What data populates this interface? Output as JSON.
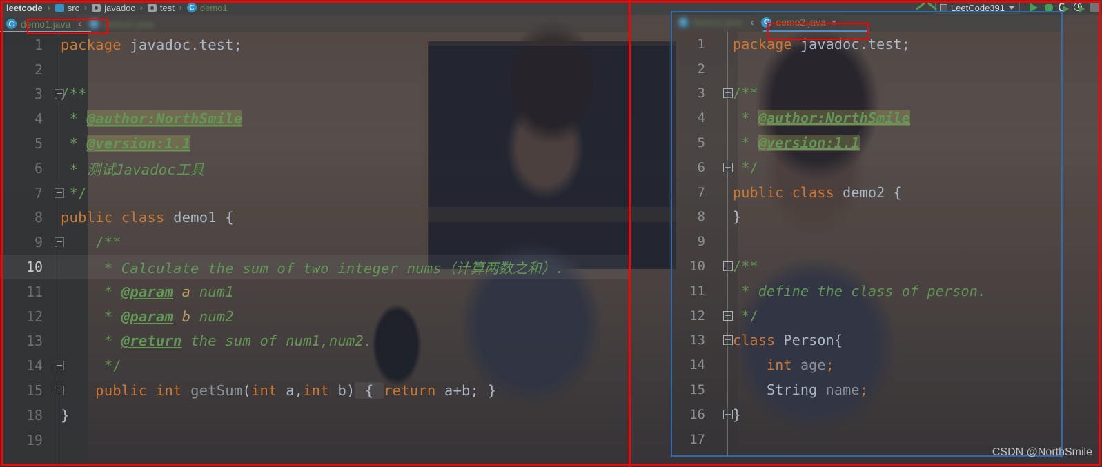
{
  "window": {
    "watermark": "CSDN @NorthSmile"
  },
  "breadcrumb": {
    "items": [
      {
        "label": "leetcode",
        "icon": "project-icon",
        "bold": true
      },
      {
        "label": "src",
        "icon": "folder-icon",
        "bold": false
      },
      {
        "label": "javadoc",
        "icon": "package-icon",
        "bold": false
      },
      {
        "label": "test",
        "icon": "package-icon",
        "bold": false
      },
      {
        "label": "demo1",
        "icon": "java-class-icon",
        "bold": false
      }
    ],
    "separator": "›"
  },
  "toolbar": {
    "hide_label": "hide-toolbar-icon",
    "run_config": "LeetCode391",
    "dropdown_caret": "▾",
    "buttons": [
      {
        "name": "run-button",
        "icon": "play-icon"
      },
      {
        "name": "debug-button",
        "icon": "bug-icon"
      },
      {
        "name": "run-with-coverage-button",
        "icon": "coverage-icon"
      },
      {
        "name": "profile-button",
        "icon": "profiler-icon"
      },
      {
        "name": "stop-button",
        "icon": "stop-icon"
      }
    ]
  },
  "left_editor": {
    "tabs": [
      {
        "label": "demo1.java",
        "active": true,
        "blurred": false,
        "icon": "java-class-icon"
      },
      {
        "label": "demo2.java",
        "active": false,
        "blurred": true,
        "icon": "java-class-icon"
      }
    ],
    "tab_overflow": "‹",
    "lines": [
      {
        "n": "1",
        "current": false,
        "fold": "",
        "tokens": [
          {
            "t": "package ",
            "c": "kw"
          },
          {
            "t": "javadoc.test",
            "c": "txt"
          },
          {
            "t": ";",
            "c": "txt"
          }
        ]
      },
      {
        "n": "2",
        "current": false,
        "fold": "",
        "tokens": []
      },
      {
        "n": "3",
        "current": false,
        "fold": "start",
        "tokens": [
          {
            "t": "/**",
            "c": "cmt-plain"
          }
        ]
      },
      {
        "n": "4",
        "current": false,
        "fold": "",
        "tokens": [
          {
            "t": " * ",
            "c": "cmt-plain"
          },
          {
            "t": "@author:NorthSmile",
            "c": "tag hlb"
          }
        ]
      },
      {
        "n": "5",
        "current": false,
        "fold": "",
        "tokens": [
          {
            "t": " * ",
            "c": "cmt-plain"
          },
          {
            "t": "@version:1.1",
            "c": "tag hlb"
          }
        ]
      },
      {
        "n": "6",
        "current": false,
        "fold": "",
        "tokens": [
          {
            "t": " * ",
            "c": "cmt-plain"
          },
          {
            "t": "测试Javadoc工具",
            "c": "cmt"
          }
        ]
      },
      {
        "n": "7",
        "current": false,
        "fold": "end",
        "tokens": [
          {
            "t": " */",
            "c": "cmt-plain"
          }
        ]
      },
      {
        "n": "8",
        "current": false,
        "fold": "",
        "tokens": [
          {
            "t": "public ",
            "c": "kw"
          },
          {
            "t": "class ",
            "c": "kw"
          },
          {
            "t": "demo1",
            "c": "txt"
          },
          {
            "t": " {",
            "c": "brace"
          }
        ]
      },
      {
        "n": "9",
        "current": false,
        "fold": "start",
        "tokens": [
          {
            "t": "    /**",
            "c": "cmt-plain"
          }
        ]
      },
      {
        "n": "10",
        "current": true,
        "fold": "",
        "tokens": [
          {
            "t": "     * ",
            "c": "cmt-plain"
          },
          {
            "t": "Calculate the sum of two integer nums（计算两数之和）.",
            "c": "cmt"
          }
        ]
      },
      {
        "n": "11",
        "current": false,
        "fold": "",
        "tokens": [
          {
            "t": "     * ",
            "c": "cmt-plain"
          },
          {
            "t": "@param",
            "c": "tagp"
          },
          {
            "t": " a",
            "c": "param"
          },
          {
            "t": " num1",
            "c": "cmt"
          }
        ]
      },
      {
        "n": "12",
        "current": false,
        "fold": "",
        "tokens": [
          {
            "t": "     * ",
            "c": "cmt-plain"
          },
          {
            "t": "@param",
            "c": "tagp"
          },
          {
            "t": " b",
            "c": "param"
          },
          {
            "t": " num2",
            "c": "cmt"
          }
        ]
      },
      {
        "n": "13",
        "current": false,
        "fold": "",
        "tokens": [
          {
            "t": "     * ",
            "c": "cmt-plain"
          },
          {
            "t": "@return",
            "c": "tagp"
          },
          {
            "t": " the sum of num1,num2.",
            "c": "cmt"
          }
        ]
      },
      {
        "n": "14",
        "current": false,
        "fold": "end",
        "tokens": [
          {
            "t": "     */",
            "c": "cmt-plain"
          }
        ]
      },
      {
        "n": "15",
        "current": false,
        "fold": "plus",
        "tokens": [
          {
            "t": "    public ",
            "c": "kw"
          },
          {
            "t": "int ",
            "c": "kw"
          },
          {
            "t": "getSum",
            "c": "mname"
          },
          {
            "t": "(",
            "c": "brace"
          },
          {
            "t": "int ",
            "c": "kw"
          },
          {
            "t": "a",
            "c": "txt"
          },
          {
            "t": ",",
            "c": "txt"
          },
          {
            "t": "int ",
            "c": "kw"
          },
          {
            "t": "b",
            "c": "txt"
          },
          {
            "t": ")",
            "c": "brace"
          },
          {
            "t": " { ",
            "c": "brace fold-chunk"
          },
          {
            "t": "return ",
            "c": "kw"
          },
          {
            "t": "a+b; }",
            "c": "txt"
          }
        ]
      },
      {
        "n": "18",
        "current": false,
        "fold": "",
        "tokens": [
          {
            "t": "}",
            "c": "brace"
          }
        ]
      },
      {
        "n": "19",
        "current": false,
        "fold": "",
        "tokens": []
      }
    ]
  },
  "float_window": {
    "tabs": [
      {
        "label": "demo1.java",
        "active": false,
        "blurred": true,
        "icon": "java-class-icon"
      },
      {
        "label": "demo2.java",
        "active": true,
        "blurred": false,
        "icon": "java-class-icon",
        "close": "×"
      }
    ],
    "tab_overflow": "‹",
    "lines": [
      {
        "n": "1",
        "current": false,
        "fold": "",
        "tokens": [
          {
            "t": "package ",
            "c": "kw"
          },
          {
            "t": "javadoc.test",
            "c": "txt"
          },
          {
            "t": ";",
            "c": "txt"
          }
        ]
      },
      {
        "n": "2",
        "current": false,
        "fold": "",
        "tokens": []
      },
      {
        "n": "3",
        "current": false,
        "fold": "start",
        "tokens": [
          {
            "t": "/**",
            "c": "cmt-plain"
          }
        ]
      },
      {
        "n": "4",
        "current": false,
        "fold": "",
        "tokens": [
          {
            "t": " * ",
            "c": "cmt-plain"
          },
          {
            "t": "@author:NorthSmile",
            "c": "tag hlb"
          }
        ]
      },
      {
        "n": "5",
        "current": false,
        "fold": "",
        "tokens": [
          {
            "t": " * ",
            "c": "cmt-plain"
          },
          {
            "t": "@version:1.1",
            "c": "tag hlb"
          }
        ]
      },
      {
        "n": "6",
        "current": false,
        "fold": "end",
        "tokens": [
          {
            "t": " */",
            "c": "cmt-plain"
          }
        ]
      },
      {
        "n": "7",
        "current": false,
        "fold": "",
        "tokens": [
          {
            "t": "public ",
            "c": "kw"
          },
          {
            "t": "class ",
            "c": "kw"
          },
          {
            "t": "demo2",
            "c": "txt"
          },
          {
            "t": " {",
            "c": "brace"
          }
        ]
      },
      {
        "n": "8",
        "current": false,
        "fold": "",
        "tokens": [
          {
            "t": "}",
            "c": "brace"
          }
        ]
      },
      {
        "n": "9",
        "current": false,
        "fold": "",
        "tokens": []
      },
      {
        "n": "10",
        "current": false,
        "fold": "start",
        "tokens": [
          {
            "t": "/**",
            "c": "cmt-plain"
          }
        ]
      },
      {
        "n": "11",
        "current": false,
        "fold": "",
        "tokens": [
          {
            "t": " * ",
            "c": "cmt-plain"
          },
          {
            "t": "define the class of person.",
            "c": "cmt"
          }
        ]
      },
      {
        "n": "12",
        "current": false,
        "fold": "end",
        "tokens": [
          {
            "t": " */",
            "c": "cmt-plain"
          }
        ]
      },
      {
        "n": "13",
        "current": false,
        "fold": "start",
        "tokens": [
          {
            "t": "class ",
            "c": "kw"
          },
          {
            "t": "Person",
            "c": "txt"
          },
          {
            "t": "{",
            "c": "brace"
          }
        ]
      },
      {
        "n": "14",
        "current": false,
        "fold": "",
        "tokens": [
          {
            "t": "    int ",
            "c": "kw"
          },
          {
            "t": "age",
            "c": "mname"
          },
          {
            "t": ";",
            "c": "kw"
          }
        ]
      },
      {
        "n": "15",
        "current": false,
        "fold": "",
        "tokens": [
          {
            "t": "    String ",
            "c": "txt"
          },
          {
            "t": "name",
            "c": "mname"
          },
          {
            "t": ";",
            "c": "kw"
          }
        ]
      },
      {
        "n": "16",
        "current": false,
        "fold": "end",
        "tokens": [
          {
            "t": "}",
            "c": "brace"
          }
        ]
      },
      {
        "n": "17",
        "current": false,
        "fold": "",
        "tokens": []
      }
    ]
  },
  "annotations": {
    "colors": {
      "highlight_rect": "#ff0000",
      "float_border": "#2d6ab5",
      "keyword": "#cc7832",
      "comment": "#629755",
      "text": "#a9b7c6",
      "tab_filename": "#6a8759",
      "run_green": "#499c54"
    },
    "rects": [
      {
        "name": "demo1-tab-highlight"
      },
      {
        "name": "demo2-tab-highlight"
      },
      {
        "name": "screenshot-border"
      },
      {
        "name": "split-divider-line"
      }
    ]
  }
}
